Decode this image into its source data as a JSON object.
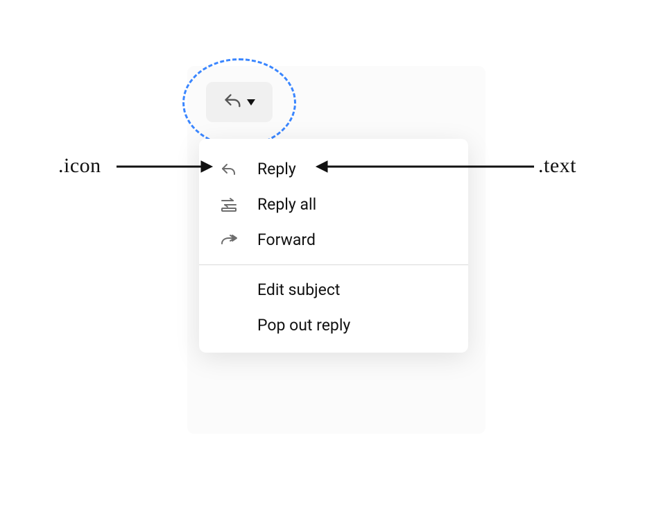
{
  "trigger": {
    "icon_name": "reply-icon",
    "has_caret": true
  },
  "menu": {
    "items": [
      {
        "icon": "reply-icon",
        "label": "Reply",
        "tag_icon": true,
        "tag_text": true
      },
      {
        "icon": "reply-all-icon",
        "label": "Reply all"
      },
      {
        "icon": "forward-icon",
        "label": "Forward"
      }
    ],
    "items_after_divider": [
      {
        "icon": null,
        "label": "Edit subject"
      },
      {
        "icon": null,
        "label": "Pop out reply"
      }
    ]
  },
  "annotations": {
    "icon_label": ".icon",
    "text_label": ".text"
  }
}
